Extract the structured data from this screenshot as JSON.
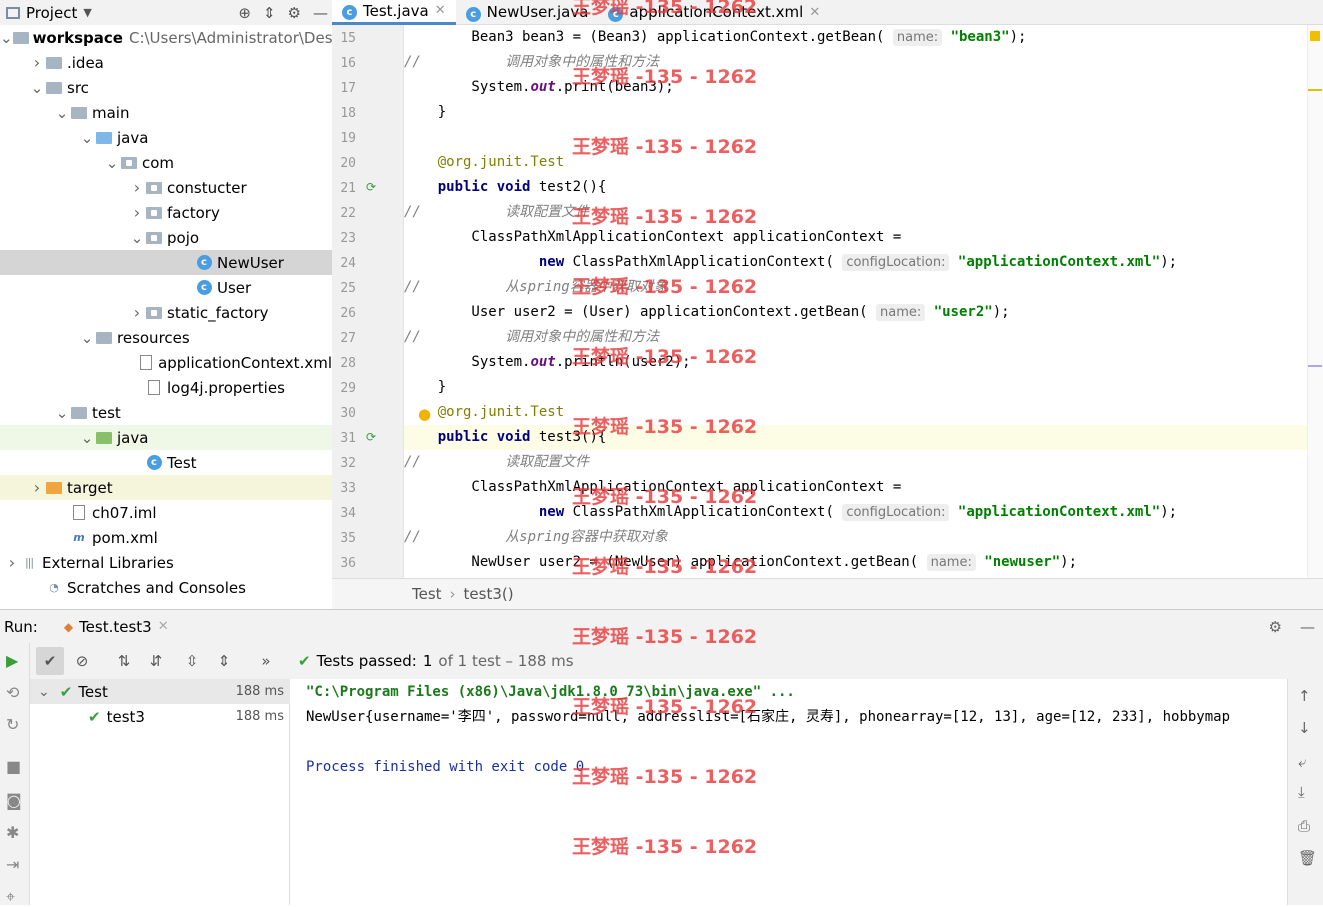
{
  "project_panel": {
    "title": "Project",
    "dropdown_icon": "chevron-down-icon"
  },
  "tree": [
    {
      "label": "workspace",
      "bold": true,
      "path": "C:\\Users\\Administrator\\Des",
      "indent": 0,
      "arrow": "down",
      "icon": "folder"
    },
    {
      "label": ".idea",
      "indent": 1,
      "arrow": "right",
      "icon": "folder"
    },
    {
      "label": "src",
      "indent": 1,
      "arrow": "down",
      "icon": "folder"
    },
    {
      "label": "main",
      "indent": 2,
      "arrow": "down",
      "icon": "folder"
    },
    {
      "label": "java",
      "indent": 3,
      "arrow": "down",
      "icon": "folder-blue"
    },
    {
      "label": "com",
      "indent": 4,
      "arrow": "down",
      "icon": "package"
    },
    {
      "label": "constucter",
      "indent": 5,
      "arrow": "right",
      "icon": "package"
    },
    {
      "label": "factory",
      "indent": 5,
      "arrow": "right",
      "icon": "package"
    },
    {
      "label": "pojo",
      "indent": 5,
      "arrow": "down",
      "icon": "package"
    },
    {
      "label": "NewUser",
      "indent": 7,
      "arrow": "",
      "icon": "class",
      "state": "sel"
    },
    {
      "label": "User",
      "indent": 7,
      "arrow": "",
      "icon": "class"
    },
    {
      "label": "static_factory",
      "indent": 5,
      "arrow": "right",
      "icon": "package"
    },
    {
      "label": "resources",
      "indent": 3,
      "arrow": "down",
      "icon": "folder"
    },
    {
      "label": "applicationContext.xml",
      "indent": 5,
      "arrow": "",
      "icon": "file"
    },
    {
      "label": "log4j.properties",
      "indent": 5,
      "arrow": "",
      "icon": "file"
    },
    {
      "label": "test",
      "indent": 2,
      "arrow": "down",
      "icon": "folder"
    },
    {
      "label": "java",
      "indent": 3,
      "arrow": "down",
      "icon": "folder-green",
      "state": "grn"
    },
    {
      "label": "Test",
      "indent": 5,
      "arrow": "",
      "icon": "class"
    },
    {
      "label": "target",
      "indent": 1,
      "arrow": "right",
      "icon": "folder-orange",
      "state": "ylw"
    },
    {
      "label": "ch07.iml",
      "indent": 2,
      "arrow": "",
      "icon": "file"
    },
    {
      "label": "pom.xml",
      "indent": 2,
      "arrow": "",
      "icon": "maven"
    },
    {
      "label": "External Libraries",
      "indent": 0,
      "arrow": "right",
      "icon": "libs"
    },
    {
      "label": "Scratches and Consoles",
      "indent": 1,
      "arrow": "",
      "icon": "scratch"
    }
  ],
  "editor_tabs": [
    {
      "label": "Test.java",
      "active": true,
      "closable": true
    },
    {
      "label": "NewUser.java",
      "active": false,
      "closable": false
    },
    {
      "label": "applicationContext.xml",
      "active": false,
      "closable": true
    }
  ],
  "code_lines": [
    {
      "n": "15",
      "html": "        Bean3 bean3 = (Bean3) applicationContext.getBean( <span class='hint'>name:</span> <span class='str'>\"bean3\"</span>);"
    },
    {
      "n": "16",
      "html": "<span class='cmt'>//          调用对象中的属性和方法</span>"
    },
    {
      "n": "17",
      "html": "        System.<span class='fld'>out</span>.print(bean3);"
    },
    {
      "n": "18",
      "html": "    }"
    },
    {
      "n": "19",
      "html": ""
    },
    {
      "n": "20",
      "html": "    <span class='ann'>@org.junit.Test</span>"
    },
    {
      "n": "21",
      "html": "    <span class='kw'>public void</span> test2(){"
    },
    {
      "n": "22",
      "html": "<span class='cmt'>//          读取配置文件</span>"
    },
    {
      "n": "23",
      "html": "        ClassPathXmlApplicationContext applicationContext ="
    },
    {
      "n": "24",
      "html": "                <span class='kw'>new</span> ClassPathXmlApplicationContext( <span class='hint'>configLocation:</span> <span class='str'>\"applicationContext.xml\"</span>);"
    },
    {
      "n": "25",
      "html": "<span class='cmt'>//          从spring容器中获取对象</span>"
    },
    {
      "n": "26",
      "html": "        User user2 = (User) applicationContext.getBean( <span class='hint'>name:</span> <span class='str'>\"user2\"</span>);"
    },
    {
      "n": "27",
      "html": "<span class='cmt'>//          调用对象中的属性和方法</span>"
    },
    {
      "n": "28",
      "html": "        System.<span class='fld'>out</span>.println(user2);"
    },
    {
      "n": "29",
      "html": "    }"
    },
    {
      "n": "30",
      "html": "    <span class='ann'>@org.junit.Test</span>"
    },
    {
      "n": "31",
      "html": "    <span class='kw'>public void</span> test3(){",
      "current": true
    },
    {
      "n": "32",
      "html": "<span class='cmt'>//          读取配置文件</span>"
    },
    {
      "n": "33",
      "html": "        ClassPathXmlApplicationContext applicationContext ="
    },
    {
      "n": "34",
      "html": "                <span class='kw'>new</span> ClassPathXmlApplicationContext( <span class='hint'>configLocation:</span> <span class='str'>\"applicationContext.xml\"</span>);"
    },
    {
      "n": "35",
      "html": "<span class='cmt'>//          从spring容器中获取对象</span>"
    },
    {
      "n": "36",
      "html": "        NewUser user2 = (NewUser) applicationContext.getBean( <span class='hint'>name:</span> <span class='str'>\"newuser\"</span>);"
    }
  ],
  "breadcrumbs": [
    "Test",
    "test3()"
  ],
  "run": {
    "label": "Run:",
    "tab": "Test.test3",
    "status_prefix": "Tests passed:",
    "status_count": "1",
    "status_suffix": "of 1 test – 188 ms",
    "tests": [
      {
        "name": "Test",
        "duration": "188 ms",
        "level": 0
      },
      {
        "name": "test3",
        "duration": "188 ms",
        "level": 1
      }
    ],
    "console": [
      "\"C:\\Program Files (x86)\\Java\\jdk1.8.0_73\\bin\\java.exe\" ...",
      "NewUser{username='李四', password=null, addresslist=[石家庄, 灵寿], phonearray=[12, 13], age=[12, 233], hobbymap",
      "",
      "Process finished with exit code 0"
    ]
  },
  "watermark": "王梦瑶 -135 - 1262"
}
